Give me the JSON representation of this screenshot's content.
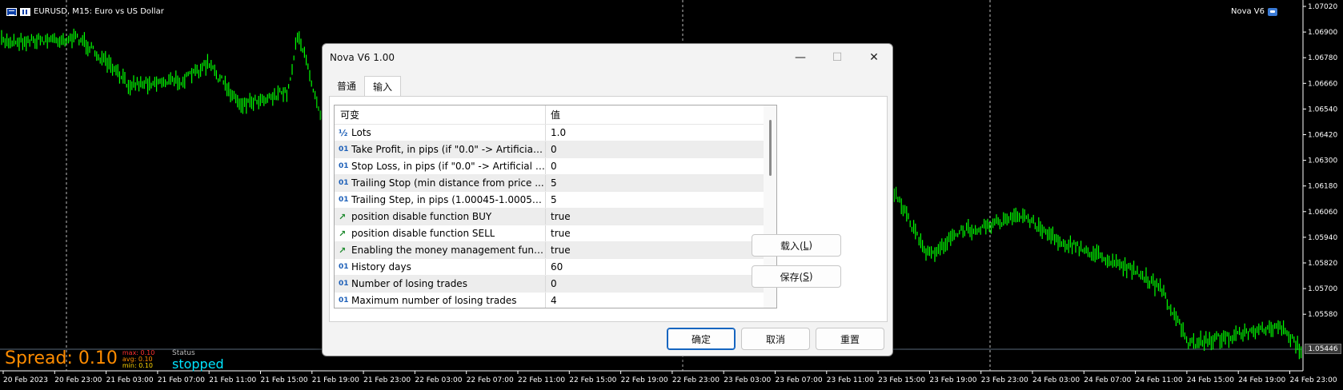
{
  "chart": {
    "symbol_label": "EURUSD, M15:  Euro vs US Dollar",
    "ea_name": "Nova V6",
    "current_price": "1.05446",
    "price_levels": [
      "1.07020",
      "1.06900",
      "1.06780",
      "1.06660",
      "1.06540",
      "1.06420",
      "1.06300",
      "1.06180",
      "1.06060",
      "1.05940",
      "1.05820",
      "1.05700",
      "1.05580"
    ],
    "time_labels": [
      "20 Feb 2023",
      "20 Feb 23:00",
      "21 Feb 03:00",
      "21 Feb 07:00",
      "21 Feb 11:00",
      "21 Feb 15:00",
      "21 Feb 19:00",
      "21 Feb 23:00",
      "22 Feb 03:00",
      "22 Feb 07:00",
      "22 Feb 11:00",
      "22 Feb 15:00",
      "22 Feb 19:00",
      "22 Feb 23:00",
      "23 Feb 03:00",
      "23 Feb 07:00",
      "23 Feb 11:00",
      "23 Feb 15:00",
      "23 Feb 19:00",
      "23 Feb 23:00",
      "24 Feb 03:00",
      "24 Feb 07:00",
      "24 Feb 11:00",
      "24 Feb 15:00",
      "24 Feb 19:00",
      "24 Feb 23:00"
    ],
    "candle_color": "#00ff00",
    "background_color": "#000000"
  },
  "spread_panel": {
    "spread_text": "Spread: 0.10",
    "max_text": "max: 0.10",
    "avg_text": "avg: 0.10",
    "min_text": "min: 0.10",
    "status_label": "Status",
    "status_value": "stopped"
  },
  "dialog": {
    "title": "Nova V6 1.00",
    "minimize_glyph": "—",
    "maximize_glyph": "☐",
    "close_glyph": "✕",
    "tabs": [
      {
        "label": "普通"
      },
      {
        "label": "输入"
      }
    ],
    "table": {
      "col_name": "可变",
      "col_value": "值",
      "rows": [
        {
          "type_icon": "½",
          "name": "Lots",
          "value": "1.0"
        },
        {
          "type_icon": "01",
          "name": "Take Profit, in pips (if \"0.0\" -> Artificial ...",
          "value": "0"
        },
        {
          "type_icon": "01",
          "name": "Stop Loss, in pips (if \"0.0\" -> Artificial I...",
          "value": "0"
        },
        {
          "type_icon": "01",
          "name": "Trailing Stop (min distance from price ...",
          "value": "5"
        },
        {
          "type_icon": "01",
          "name": "Trailing Step, in pips (1.00045-1.00055...",
          "value": "5"
        },
        {
          "type_icon": "↗",
          "name": "position disable function BUY",
          "value": "true"
        },
        {
          "type_icon": "↗",
          "name": "position disable function SELL",
          "value": "true"
        },
        {
          "type_icon": "↗",
          "name": "Enabling the money management funct...",
          "value": "true"
        },
        {
          "type_icon": "01",
          "name": "History days",
          "value": "60"
        },
        {
          "type_icon": "01",
          "name": "Number of losing trades",
          "value": "0"
        },
        {
          "type_icon": "01",
          "name": "Maximum number of losing trades",
          "value": "4"
        }
      ]
    },
    "load_label": "载入(",
    "load_key": "L",
    "load_suffix": ")",
    "save_label": "保存(",
    "save_key": "S",
    "save_suffix": ")",
    "ok_label": "确定",
    "cancel_label": "取消",
    "reset_label": "重置"
  }
}
